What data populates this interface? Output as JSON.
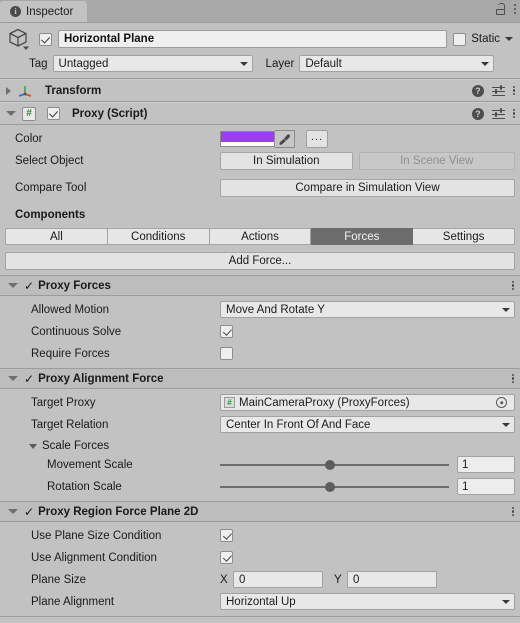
{
  "window": {
    "tab_label": "Inspector",
    "tab_icon": "info-icon",
    "lock_icon": "lock-open-icon",
    "menu_icon": "kebab-menu-icon"
  },
  "gameobject": {
    "icon": "cube-icon",
    "enabled": true,
    "name": "Horizontal Plane",
    "static_label": "Static",
    "static_checked": false,
    "tag_label": "Tag",
    "tag_value": "Untagged",
    "layer_label": "Layer",
    "layer_value": "Default"
  },
  "components": [
    {
      "title": "Transform",
      "icon": "transform-axis-icon",
      "expanded": false
    },
    {
      "title": "Proxy (Script)",
      "icon": "script-icon",
      "expanded": true,
      "enabled": true
    }
  ],
  "proxy": {
    "color_label": "Color",
    "color_value": "#9B3CF6",
    "eyedropper_icon": "eyedropper-icon",
    "more_button_label": "...",
    "select_object_label": "Select Object",
    "in_simulation_label": "In Simulation",
    "in_scene_view_label": "In Scene View",
    "in_scene_view_disabled": true,
    "compare_tool_label": "Compare Tool",
    "compare_button_label": "Compare in Simulation View",
    "components_header": "Components",
    "tabs": [
      "All",
      "Conditions",
      "Actions",
      "Forces",
      "Settings"
    ],
    "active_tab": "Forces",
    "add_force_label": "Add Force..."
  },
  "proxy_forces": {
    "title": "Proxy Forces",
    "enabled": true,
    "allowed_motion_label": "Allowed Motion",
    "allowed_motion_value": "Move And Rotate Y",
    "continuous_solve_label": "Continuous Solve",
    "continuous_solve_checked": true,
    "require_forces_label": "Require Forces",
    "require_forces_checked": false
  },
  "proxy_alignment_force": {
    "title": "Proxy Alignment Force",
    "enabled": true,
    "target_proxy_label": "Target Proxy",
    "target_proxy_value": "MainCameraProxy (ProxyForces)",
    "target_proxy_icon": "script-icon",
    "target_picker_icon": "object-picker-icon",
    "target_relation_label": "Target Relation",
    "target_relation_value": "Center In Front Of And Face",
    "scale_forces_label": "Scale Forces",
    "movement_scale_label": "Movement Scale",
    "movement_scale_value": "1",
    "movement_scale_pct": 48,
    "rotation_scale_label": "Rotation Scale",
    "rotation_scale_value": "1",
    "rotation_scale_pct": 48
  },
  "proxy_region_force_plane_2d": {
    "title": "Proxy Region Force Plane 2D",
    "enabled": true,
    "use_plane_size_condition_label": "Use Plane Size Condition",
    "use_plane_size_condition_checked": true,
    "use_alignment_condition_label": "Use Alignment Condition",
    "use_alignment_condition_checked": true,
    "plane_size_label": "Plane Size",
    "plane_size_x_axis": "X",
    "plane_size_x": "0",
    "plane_size_y_axis": "Y",
    "plane_size_y": "0",
    "plane_alignment_label": "Plane Alignment",
    "plane_alignment_value": "Horizontal Up"
  }
}
